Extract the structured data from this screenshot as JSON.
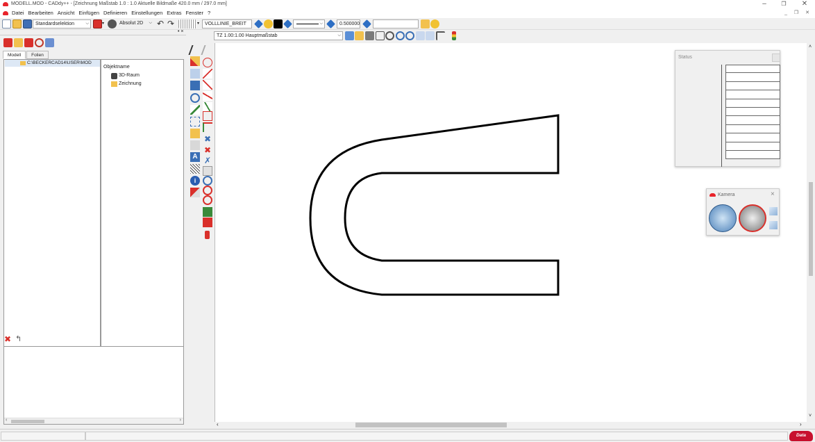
{
  "window": {
    "title": "MODELL.MOD - CADdy++ - [Zeichnung   Maßstab 1.0 : 1.0   Aktuelle Bildmaße 420.0 mm / 297.0 mm]",
    "minimize": "–",
    "restore": "❐",
    "close": "✕",
    "mdi_controls": "_ ❐ ✕"
  },
  "menu": {
    "items": [
      "Datei",
      "Bearbeiten",
      "Ansicht",
      "Einfügen",
      "Definieren",
      "Einstellungen",
      "Extras",
      "Fenster",
      "?"
    ]
  },
  "toolbar": {
    "selection_mode": "Standardselektion",
    "coord_mode": "Absolut 2D",
    "line_type": "VOLLLINIE_BREIT",
    "line_width": "0.500000",
    "text_field": ""
  },
  "toolbar2": {
    "scale_select": "TZ 1.00:1.00 Hauptmaßstab"
  },
  "left_panel": {
    "tabs": [
      "Modell",
      "Folien"
    ],
    "tree_root": "C:\\BECKERCAD14\\USER\\MOD",
    "object_header": "Objektname",
    "objects": [
      "3D-Raum",
      "Zeichnung"
    ]
  },
  "status_window": {
    "title": "Status",
    "rows": 11
  },
  "kamera_window": {
    "title": "Kamera"
  },
  "brand": {
    "logo_text": "Data\nsolid",
    "accent": "#e8242b"
  }
}
